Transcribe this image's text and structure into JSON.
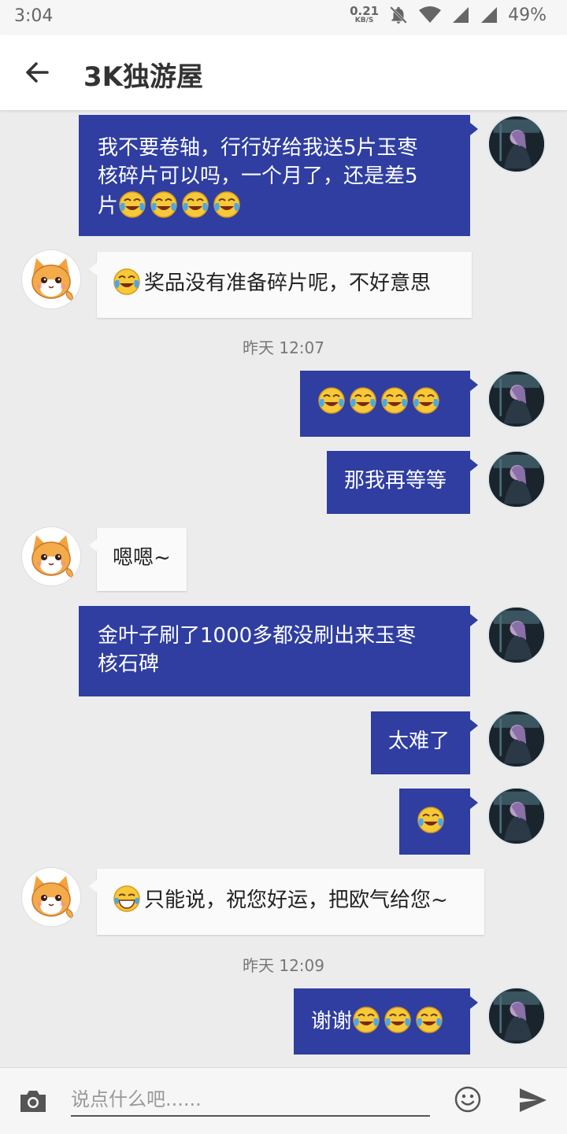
{
  "status_bar": {
    "time": "3:04",
    "net_speed_value": "0.21",
    "net_speed_unit": "KB/S",
    "battery": "49%",
    "icons": [
      "bell-off-icon",
      "wifi-icon",
      "signal-icon",
      "signal-icon"
    ]
  },
  "header": {
    "title": "3K独游屋"
  },
  "timestamps": [
    "昨天 12:07",
    "昨天 12:09"
  ],
  "messages": [
    {
      "from": "me",
      "line1": "我不要卷轴，行行好给我送5片玉枣",
      "line2": "核碎片可以吗，一个月了，还是差5",
      "line3": "片",
      "emoji_count": 4
    },
    {
      "from": "service",
      "emoji": "laugh-cry",
      "text": "奖品没有准备碎片呢，不好意思"
    },
    {
      "from": "me",
      "emoji_count": 4
    },
    {
      "from": "me",
      "text": "那我再等等"
    },
    {
      "from": "service",
      "text": "嗯嗯~"
    },
    {
      "from": "me",
      "line1": "金叶子刷了1000多都没刷出来玉枣",
      "line2": "核石碑"
    },
    {
      "from": "me",
      "text": "太难了"
    },
    {
      "from": "me",
      "emoji_count": 1
    },
    {
      "from": "service",
      "emoji": "tears-of-joy",
      "text": "只能说，祝您好运，把欧气给您~"
    },
    {
      "from": "me",
      "text": "谢谢",
      "emoji_count": 3
    }
  ],
  "input": {
    "placeholder": "说点什么吧......"
  },
  "colors": {
    "outgoing_bubble": "#2f3ea0",
    "incoming_bubble": "#fafafa",
    "background": "#ececec"
  }
}
